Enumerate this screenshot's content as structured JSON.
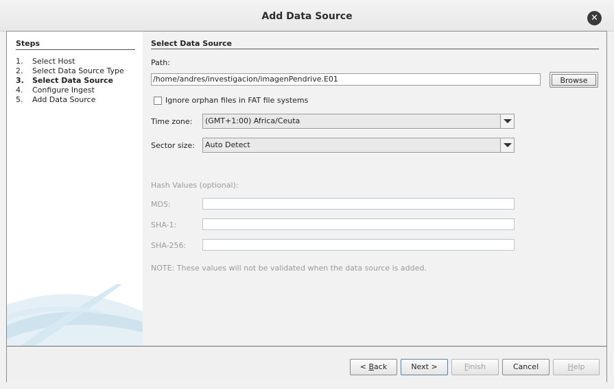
{
  "window": {
    "title": "Add Data Source"
  },
  "steps": {
    "header": "Steps",
    "items": [
      {
        "num": "1.",
        "label": "Select Host"
      },
      {
        "num": "2.",
        "label": "Select Data Source Type"
      },
      {
        "num": "3.",
        "label": "Select Data Source"
      },
      {
        "num": "4.",
        "label": "Configure Ingest"
      },
      {
        "num": "5.",
        "label": "Add Data Source"
      }
    ],
    "current_index": 2
  },
  "panel": {
    "title": "Select Data Source",
    "path_label": "Path:",
    "path_value": "/home/andres/investigacion/imagenPendrive.E01",
    "browse_label": "Browse",
    "orphan_checkbox_label": "Ignore orphan files in FAT file systems",
    "orphan_checked": false,
    "timezone_label": "Time zone:",
    "timezone_value": "(GMT+1:00) Africa/Ceuta",
    "sector_label": "Sector size:",
    "sector_value": "Auto Detect",
    "hash_header": "Hash Values (optional):",
    "md5_label": "MD5:",
    "md5_value": "",
    "sha1_label": "SHA-1:",
    "sha1_value": "",
    "sha256_label": "SHA-256:",
    "sha256_value": "",
    "note": "NOTE: These values will not be validated when the data source is added."
  },
  "buttons": {
    "back": {
      "prefix": "< ",
      "mnemonic": "B",
      "rest": "ack"
    },
    "next": "Next >",
    "finish": {
      "mnemonic": "F",
      "rest": "inish"
    },
    "cancel": "Cancel",
    "help": {
      "mnemonic": "H",
      "rest": "elp"
    }
  },
  "colors": {
    "accent_focus": "#5c7fa8",
    "swoosh": "#cfe3ef"
  },
  "icons": {
    "close": "close-icon",
    "dropdown": "chevron-down-icon"
  }
}
